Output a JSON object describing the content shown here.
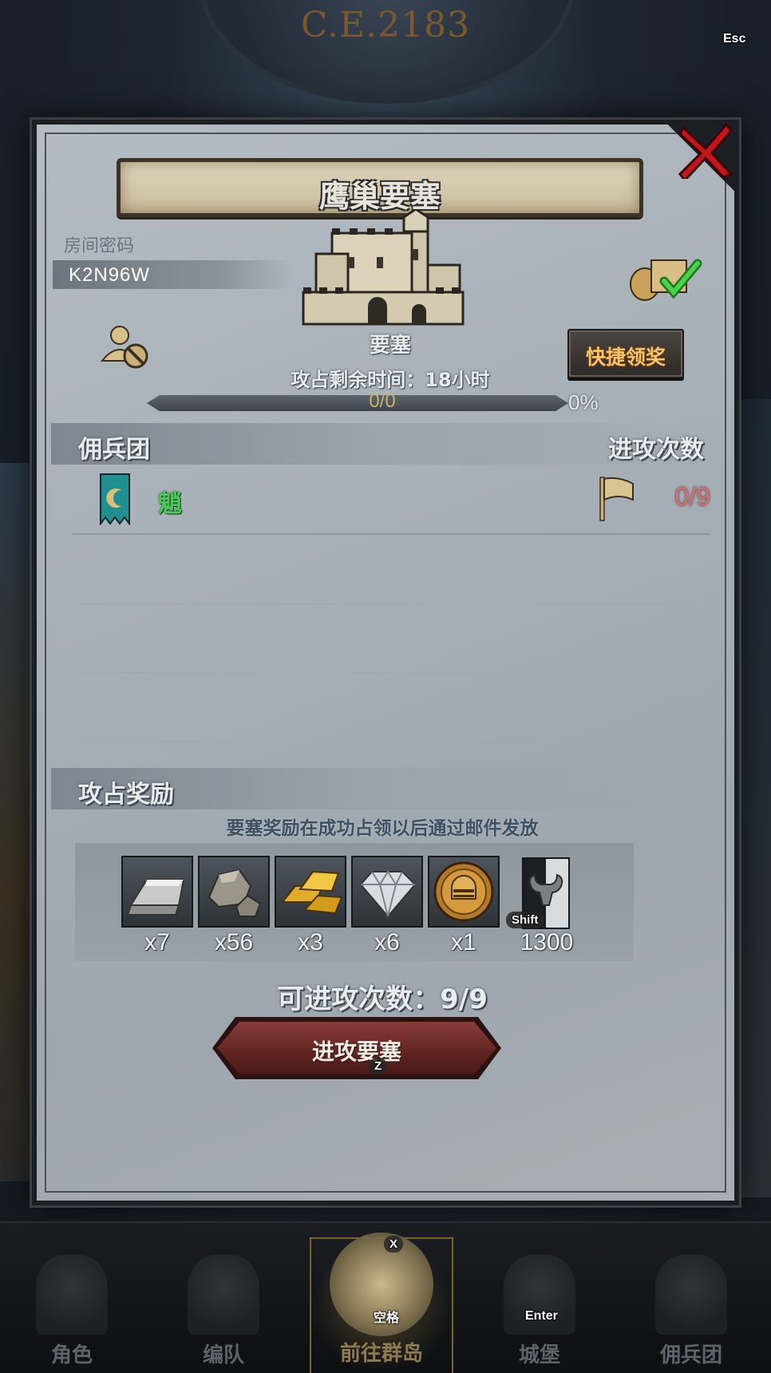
{
  "hud": {
    "era": "C.E.2183"
  },
  "keys": {
    "esc": "Esc",
    "shift": "Shift",
    "z": "Z",
    "x": "X",
    "space": "空格",
    "enter": "Enter"
  },
  "dialog": {
    "title": "鹰巢要塞",
    "room_code_label": "房间密码",
    "room_code": "K2N96W",
    "fortress_type": "要塞",
    "quick_claim": "快捷领奖",
    "remaining_time": "攻占剩余时间：18小时",
    "progress": {
      "count": "0/0",
      "percent_text": "0%",
      "value": 0
    },
    "mercenary_section": {
      "title": "佣兵团",
      "attacks_header": "进攻次数",
      "rows": [
        {
          "name": "魈",
          "attacks": "0/9"
        }
      ]
    },
    "rewards_section": {
      "title": "攻占奖励",
      "hint": "要塞奖励在成功占领以后通过邮件发放",
      "items": [
        {
          "icon": "iron-ingot-icon",
          "qty": "x7"
        },
        {
          "icon": "stone-ore-icon",
          "qty": "x56"
        },
        {
          "icon": "gold-bars-icon",
          "qty": "x3"
        },
        {
          "icon": "diamond-icon",
          "qty": "x6"
        },
        {
          "icon": "knight-helmet-coin-icon",
          "qty": "x1"
        },
        {
          "icon": "bull-banner-icon",
          "qty": "1300"
        }
      ]
    },
    "attack_available": "可进攻次数：9/9",
    "attack_button": "进攻要塞"
  },
  "bottom_nav": [
    {
      "label": "角色",
      "active": false
    },
    {
      "label": "编队",
      "active": false
    },
    {
      "label": "前往群岛",
      "active": true
    },
    {
      "label": "城堡",
      "active": false
    },
    {
      "label": "佣兵团",
      "active": false
    }
  ],
  "colors": {
    "accent_gold": "#f3c56c",
    "merc_name_green": "#4ec85c",
    "attack_count_red": "#d2706f",
    "attack_button_red": "#8a3c3a"
  }
}
